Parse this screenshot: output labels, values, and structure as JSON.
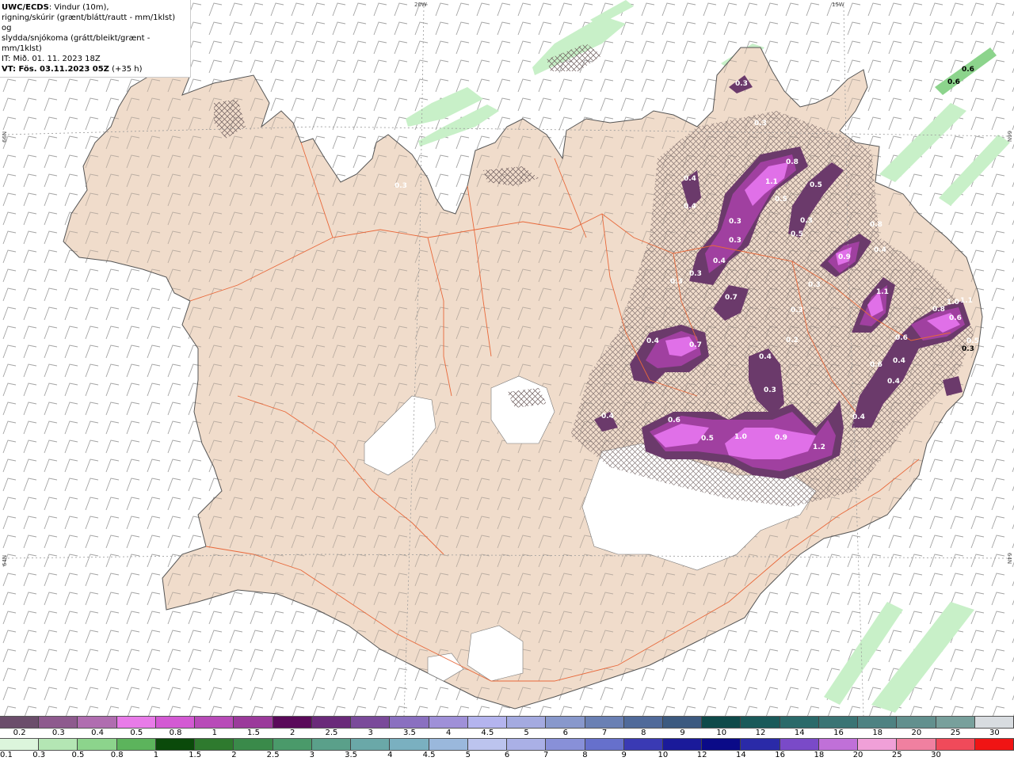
{
  "header": {
    "product": "UWC/ECDS",
    "line1_rest": ": Vindur (10m),",
    "line2": "rigning/skúrir (grænt/blátt/rautt - mm/1klst) og",
    "line3": "slydda/snjókoma (grátt/bleikt/grænt - mm/1klst)",
    "issue_time": "IT: Mið. 01. 11. 2023 18Z",
    "valid_prefix": "VT: Fös. 03.11.2023 05Z",
    "valid_suffix": " (+35 h)"
  },
  "grid_labels": {
    "lon_20w": "20W",
    "lon_15w": "15W",
    "lat_left_66": "66N",
    "lat_right_66": "66N",
    "lat_left_64": "64N",
    "lat_right_64": "64N"
  },
  "precip_labels": [
    {
      "t": "0.6"
    },
    {
      "t": "0.6"
    },
    {
      "t": "0.3"
    },
    {
      "t": "0.3"
    },
    {
      "t": "0.8"
    },
    {
      "t": "1.1"
    },
    {
      "t": "0.5"
    },
    {
      "t": "0.5"
    },
    {
      "t": "0.4"
    },
    {
      "t": "0.4"
    },
    {
      "t": "0.3"
    },
    {
      "t": "0.3"
    },
    {
      "t": "0.4"
    },
    {
      "t": "0.3"
    },
    {
      "t": "0.7"
    },
    {
      "t": "0.8"
    },
    {
      "t": "0.9"
    },
    {
      "t": "0.4"
    },
    {
      "t": "1.1"
    },
    {
      "t": "0.3"
    },
    {
      "t": "0.3"
    },
    {
      "t": "0.4"
    },
    {
      "t": "0.7"
    },
    {
      "t": "0.4"
    },
    {
      "t": "0.3"
    },
    {
      "t": "0.6"
    },
    {
      "t": "0.4"
    },
    {
      "t": "0.4"
    },
    {
      "t": "0.4"
    },
    {
      "t": "0.6"
    },
    {
      "t": "0.5"
    },
    {
      "t": "1.0"
    },
    {
      "t": "0.9"
    },
    {
      "t": "1.2"
    },
    {
      "t": "0.8"
    },
    {
      "t": "1.0"
    },
    {
      "t": "1.1"
    },
    {
      "t": "0.6"
    },
    {
      "t": "0.6"
    },
    {
      "t": "0.5"
    },
    {
      "t": "0.4"
    },
    {
      "t": "0.3"
    },
    {
      "t": "0.5"
    },
    {
      "t": "0.3"
    },
    {
      "t": "0.3"
    },
    {
      "t": "0.2"
    },
    {
      "t": "0.3"
    }
  ],
  "snow_scale": {
    "colors": [
      "#6b4d6b",
      "#8e5a8e",
      "#b06db0",
      "#e87be8",
      "#d35ad3",
      "#b84bb8",
      "#9b3a9b",
      "#5a0a5a",
      "#6a2a7a",
      "#7a4a9a",
      "#8a70c0",
      "#9f90d8",
      "#b4b4ee",
      "#a4aae0",
      "#8898cc",
      "#6a80b4",
      "#506a9a",
      "#3c5a80",
      "#0e4a4a",
      "#1a5a5a",
      "#2a6a6a",
      "#3a7474",
      "#4e8282",
      "#62908e",
      "#78a09c",
      "#d8dce0"
    ],
    "labels": [
      "0.2",
      "0.3",
      "0.4",
      "0.5",
      "0.8",
      "1",
      "1.5",
      "2",
      "2.5",
      "3",
      "3.5",
      "4",
      "4.5",
      "5",
      "6",
      "7",
      "8",
      "9",
      "10",
      "12",
      "14",
      "16",
      "18",
      "20",
      "25",
      "30"
    ]
  },
  "rain_scale": {
    "colors": [
      "#dcf5dc",
      "#b4e6b4",
      "#8cd48c",
      "#5cb45c",
      "#0a4a0a",
      "#2e7a2e",
      "#3a8a4a",
      "#4a9a6a",
      "#5aa08a",
      "#6aa8a8",
      "#7ab0c0",
      "#9ab8dc",
      "#bcc4ee",
      "#aab0e6",
      "#8890d8",
      "#6670cc",
      "#3a3ab4",
      "#1a1a9a",
      "#0a0a88",
      "#2a2aa8",
      "#7a4ac8",
      "#c070d8",
      "#f0a0d8",
      "#f080a0",
      "#f04a5a",
      "#f01414"
    ],
    "labels": [
      "0.1",
      "0.3",
      "0.5",
      "0.8",
      "1",
      "1.5",
      "2",
      "2.5",
      "3",
      "3.5",
      "4",
      "4.5",
      "5",
      "6",
      "7",
      "8",
      "9",
      "10",
      "12",
      "14",
      "16",
      "18",
      "20",
      "25",
      "30"
    ]
  },
  "colors": {
    "land": "#f0dccb",
    "glacier": "#ffffff",
    "road": "#e8683a",
    "coast": "#555555",
    "snow_light": "#6b3a6b",
    "snow_mid": "#a040a0",
    "snow_heavy": "#e070e8",
    "rain_light": "#c8f0c8"
  }
}
